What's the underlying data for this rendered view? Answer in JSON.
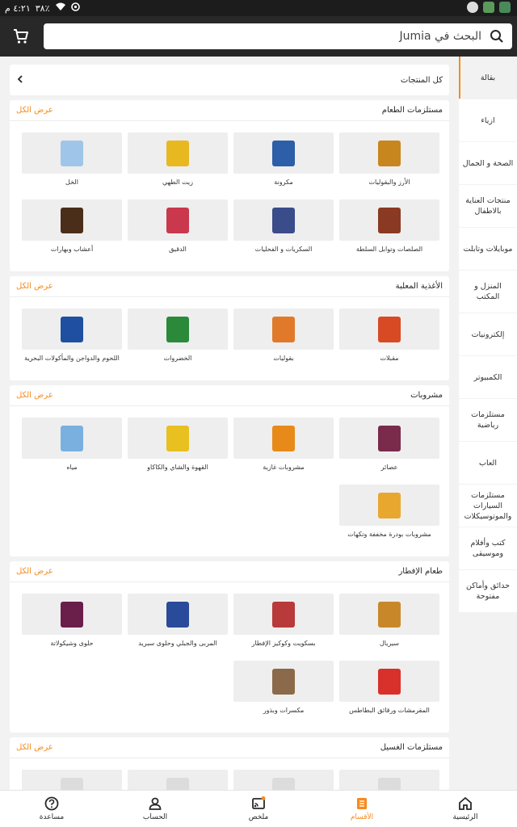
{
  "status_bar": {
    "time": "٤:٢١ م",
    "battery": "٣٨٪"
  },
  "search": {
    "placeholder": "البحث في Jumia"
  },
  "sidebar": {
    "items": [
      {
        "label": "بقالة",
        "active": true
      },
      {
        "label": "ازياء"
      },
      {
        "label": "الصحة و الجمال"
      },
      {
        "label": "منتجات العناية بالاطفال"
      },
      {
        "label": "موبايلات وتابلت"
      },
      {
        "label": "المنزل و المكتب"
      },
      {
        "label": "إلكترونيات"
      },
      {
        "label": "الكمبيوتر"
      },
      {
        "label": "مستلزمات رياضية"
      },
      {
        "label": "العاب"
      },
      {
        "label": "مستلزمات السيارات والموتوسيكلات"
      },
      {
        "label": "كتب وأفلام وموسيقى"
      },
      {
        "label": "حدائق وأماكن مفتوحة"
      }
    ]
  },
  "all_products": {
    "label": "كل المنتجات"
  },
  "see_all_label": "عرض الكل",
  "sections": [
    {
      "title": "مستلزمات الطعام",
      "items": [
        {
          "label": "الأرز والبقوليات",
          "color": "#c8861e"
        },
        {
          "label": "مكرونة",
          "color": "#2c5fa8"
        },
        {
          "label": "زيت الطهي",
          "color": "#e8b820"
        },
        {
          "label": "الخل",
          "color": "#9fc6e8"
        },
        {
          "label": "الصلصات وتوابل السلطة",
          "color": "#8a3a22"
        },
        {
          "label": "السكريات و الفحليات",
          "color": "#3a4c8a"
        },
        {
          "label": "الدقيق",
          "color": "#c9384c"
        },
        {
          "label": "أعشاب وبهارات",
          "color": "#4a2e1a"
        }
      ]
    },
    {
      "title": "الأغذية المعلبة",
      "items": [
        {
          "label": "مقبلات",
          "color": "#d84a24"
        },
        {
          "label": "بقوليات",
          "color": "#e07a2a"
        },
        {
          "label": "الخضروات",
          "color": "#2a8a3a"
        },
        {
          "label": "اللحوم والدواجن والمأكولات البحرية",
          "color": "#1e4fa0"
        }
      ]
    },
    {
      "title": "مشروبات",
      "items": [
        {
          "label": "عصائر",
          "color": "#7a2a4a"
        },
        {
          "label": "مشروبات غازية",
          "color": "#e88a1a"
        },
        {
          "label": "القهوة والشاي والكاكاو",
          "color": "#e8c020"
        },
        {
          "label": "مياه",
          "color": "#7ab0e0"
        },
        {
          "label": "مشروبات بودرة مخففة وتكهات",
          "color": "#e8a830"
        }
      ]
    },
    {
      "title": "طعام الإفطار",
      "items": [
        {
          "label": "سيريال",
          "color": "#c8882a"
        },
        {
          "label": "بسكويت وكوكيز الإفطار",
          "color": "#b83a3a"
        },
        {
          "label": "المربى والجبلي وحلوى سبريد",
          "color": "#2a4a9a"
        },
        {
          "label": "حلوى وشيكولاتة",
          "color": "#6a1e4a"
        },
        {
          "label": "المقرمشات ورقائق البطاطس",
          "color": "#d8302a"
        },
        {
          "label": "مكسرات وبذور",
          "color": "#8a6a4a"
        }
      ]
    },
    {
      "title": "مستلزمات الغسيل",
      "items": []
    }
  ],
  "bottom_nav": [
    {
      "label": "الرئيسية",
      "icon": "home-icon"
    },
    {
      "label": "الأقسام",
      "icon": "categories-icon",
      "active": true
    },
    {
      "label": "ملخص",
      "icon": "feed-icon"
    },
    {
      "label": "الحساب",
      "icon": "account-icon"
    },
    {
      "label": "مساعدة",
      "icon": "help-icon"
    }
  ],
  "colors": {
    "accent": "#f68b1e",
    "appbar": "#282828"
  }
}
